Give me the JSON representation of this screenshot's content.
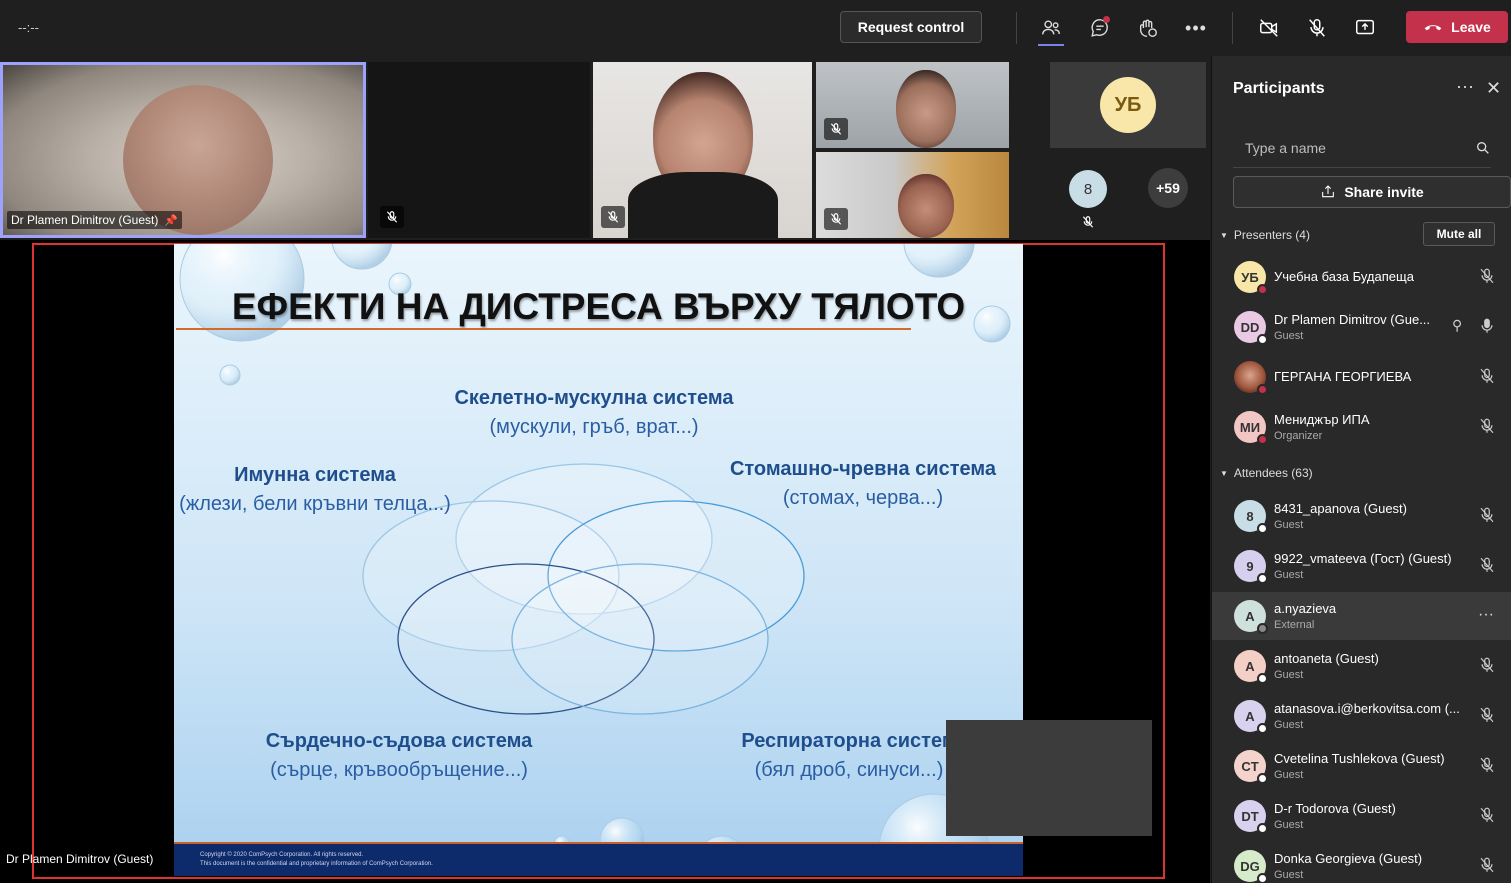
{
  "topbar": {
    "timer": "--:--",
    "request_control": "Request control",
    "leave": "Leave",
    "icons": [
      "participants-icon",
      "chat-icon",
      "reactions-icon",
      "more-icon",
      "camera-off-icon",
      "mic-off-icon",
      "share-icon"
    ]
  },
  "videos": {
    "main_speaker": "Dr Plamen Dimitrov (Guest)",
    "avatar_initials": "УБ",
    "count_badge": "8",
    "overflow": "+59"
  },
  "slide": {
    "title": "ЕФЕКТИ НА ДИСТРЕСА ВЪРХУ ТЯЛОТО",
    "items": [
      {
        "heading": "Скелетно-мускулна система",
        "sub": "(мускули, гръб, врат...)"
      },
      {
        "heading": "Имунна система",
        "sub": "(жлези, бели кръвни телца...)"
      },
      {
        "heading": "Стомашно-чревна система",
        "sub": "(стомах, черва...)"
      },
      {
        "heading": "Сърдечно-съдова система",
        "sub": "(сърце, кръвообръщение...)"
      },
      {
        "heading": "Респираторна систем",
        "sub": "(бял дроб, синуси...)"
      }
    ],
    "footer_line1": "Copyright © 2020 ComPsych Corporation. All rights reserved.",
    "footer_line2": "This document is the confidential and proprietary information of ComPsych Corporation."
  },
  "stage_name": "Dr Plamen Dimitrov (Guest)",
  "participants": {
    "title": "Participants",
    "search_placeholder": "Type a name",
    "share_invite": "Share invite",
    "presenters_label": "Presenters (4)",
    "mute_all": "Mute all",
    "attendees_label": "Attendees (63)",
    "presenters": [
      {
        "initials": "УБ",
        "name": "Учебна база Будапеща",
        "role": "",
        "color": "#f8e7a8",
        "status": "#c4314b"
      },
      {
        "initials": "DD",
        "name": "Dr Plamen Dimitrov (Gue...",
        "role": "Guest",
        "color": "#e9c9e4",
        "status": "#ffffff"
      },
      {
        "initials": "",
        "name": "ГЕРГАНА ГЕОРГИЕВА",
        "role": "",
        "color": "#b7563d",
        "status": "#c4314b"
      },
      {
        "initials": "МИ",
        "name": "Мениджър ИПА",
        "role": "Organizer",
        "color": "#f3c6c6",
        "status": "#c4314b"
      }
    ],
    "attendees": [
      {
        "initials": "8",
        "name": "8431_apanova (Guest)",
        "role": "Guest",
        "color": "#c9dde6",
        "status": "#ffffff"
      },
      {
        "initials": "9",
        "name": "9922_vmateeva (Гост) (Guest)",
        "role": "Guest",
        "color": "#d6d0ee",
        "status": "#ffffff"
      },
      {
        "initials": "A",
        "name": "a.nyazieva",
        "role": "External",
        "color": "#cfe1dc",
        "status": "#8a8a8a"
      },
      {
        "initials": "A",
        "name": "antoaneta (Guest)",
        "role": "Guest",
        "color": "#f4cfc6",
        "status": "#ffffff"
      },
      {
        "initials": "A",
        "name": "atanasova.i@berkovitsa.com (...",
        "role": "Guest",
        "color": "#d9d2ef",
        "status": "#ffffff"
      },
      {
        "initials": "CT",
        "name": "Cvetelina Tushlekova (Guest)",
        "role": "Guest",
        "color": "#f4d3cc",
        "status": "#ffffff"
      },
      {
        "initials": "DT",
        "name": "D-r Todorova (Guest)",
        "role": "Guest",
        "color": "#d9d2ef",
        "status": "#ffffff"
      },
      {
        "initials": "DG",
        "name": "Donka Georgieva (Guest)",
        "role": "Guest",
        "color": "#d6ebc9",
        "status": "#ffffff"
      }
    ]
  }
}
